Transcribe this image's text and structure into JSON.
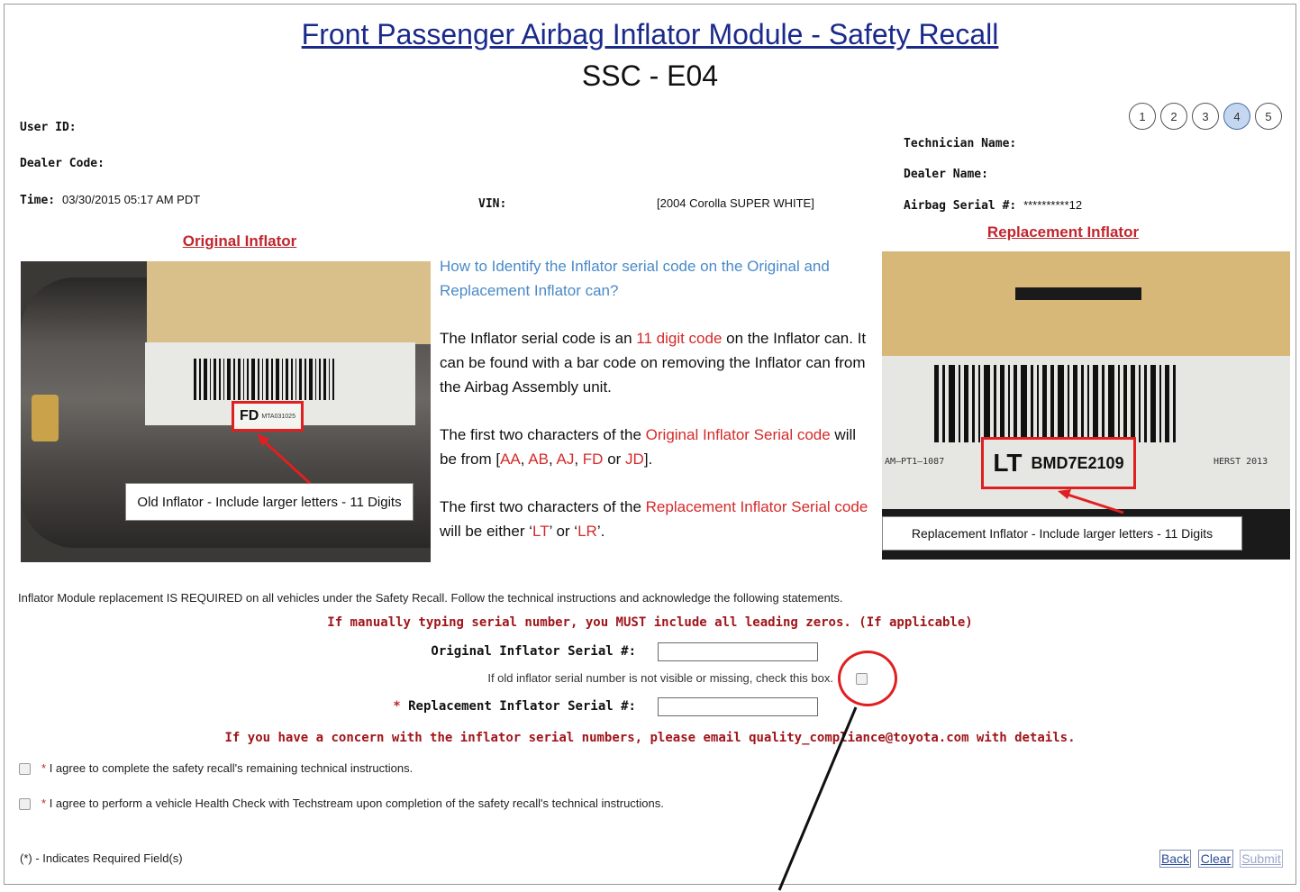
{
  "header": {
    "title": "Front Passenger Airbag Inflator Module - Safety Recall",
    "subtitle": "SSC - E04",
    "steps": [
      "1",
      "2",
      "3",
      "4",
      "5"
    ],
    "active_step": "4"
  },
  "info": {
    "user_id_label": "User ID:",
    "dealer_code_label": "Dealer Code:",
    "time_label": "Time:",
    "time_value": "03/30/2015 05:17 AM PDT",
    "vin_label": "VIN:",
    "vehicle": "[2004 Corolla SUPER WHITE]",
    "technician_label": "Technician Name:",
    "dealer_name_label": "Dealer Name:",
    "airbag_serial_label": "Airbag Serial #:",
    "airbag_serial_value": "**********12"
  },
  "original": {
    "heading": "Original Inflator",
    "photo_code_prefix": "FD",
    "photo_code": "MTA031025",
    "caption": "Old Inflator - Include larger letters - 11 Digits"
  },
  "replacement": {
    "heading": "Replacement Inflator",
    "photo_code_prefix": "LT",
    "photo_code": "BMD7E2109",
    "photo_left_text": "AM–PT1–1087",
    "photo_right_text": "HERST 2013",
    "caption": "Replacement Inflator - Include larger letters - 11 Digits"
  },
  "howto": {
    "question": "How to Identify the Inflator serial code on the Original and Replacement Inflator can?",
    "p1_a": "The Inflator serial code is an ",
    "p1_red": "11 digit code",
    "p1_b": " on the Inflator can. It can be found with a bar code on removing the Inflator can from the Airbag Assembly unit.",
    "p2_a": "The first two characters of the ",
    "p2_red": "Original Inflator Serial code",
    "p2_b": " will be from [",
    "p2_codes": [
      "AA",
      "AB",
      "AJ",
      "FD",
      "JD"
    ],
    "p2_end": "].",
    "p3_a": "The first two characters of the ",
    "p3_red": "Replacement Inflator Serial code",
    "p3_b": " will be either ‘",
    "p3_code1": "LT",
    "p3_mid": "’ or ‘",
    "p3_code2": "LR",
    "p3_end": "’."
  },
  "form": {
    "notice": "Inflator Module replacement IS REQUIRED on all vehicles under the Safety Recall. Follow the technical instructions and acknowledge the following statements.",
    "warning": "If manually typing serial number, you MUST include all leading zeros. (If applicable)",
    "original_serial_label": "Original Inflator Serial #:",
    "original_serial_value": "",
    "missing_hint": "If old inflator serial number is not visible or missing, check this box.",
    "replacement_serial_label": "Replacement Inflator Serial #:",
    "replacement_serial_value": "",
    "concern": "If you have a concern with the inflator serial numbers, please email quality_compliance@toyota.com with details.",
    "agree1": "I agree to complete the safety recall's remaining technical instructions.",
    "agree2": "I agree to perform a vehicle Health Check with Techstream upon completion of the safety recall's technical instructions.",
    "required_note_star": "(*)",
    "required_note": " - Indicates Required Field(s)"
  },
  "buttons": {
    "back": "Back",
    "clear": "Clear",
    "submit": "Submit"
  },
  "colors": {
    "title_blue": "#1a2a8a",
    "accent_red": "#c0262e",
    "callout_red": "#e02020",
    "question_blue": "#4a8ac8"
  }
}
